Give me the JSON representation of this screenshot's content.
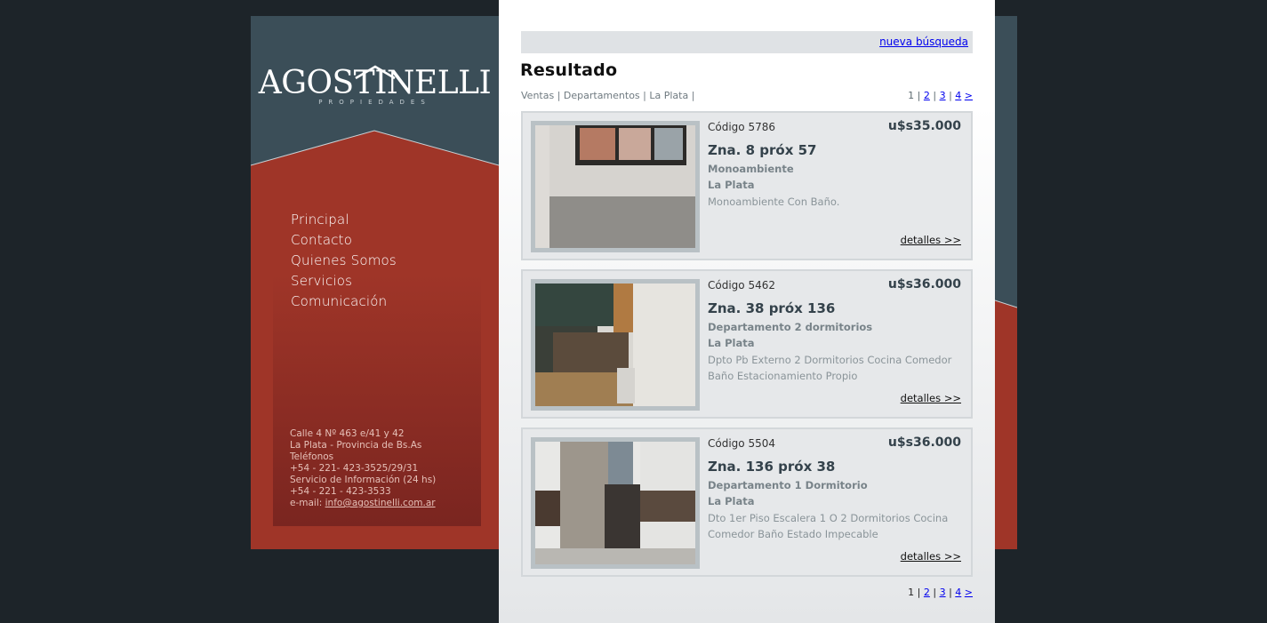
{
  "brand": {
    "name": "AGOSTINELLI",
    "subtitle": "PROPIEDADES"
  },
  "menu": [
    "Principal",
    "Contacto",
    "Quienes Somos",
    "Servicios",
    "Comunicación"
  ],
  "address": {
    "line1": "Calle 4 Nº 463 e/41 y 42",
    "line2": "La Plata - Provincia de Bs.As",
    "line3": "Teléfonos",
    "line4": "+54 - 221- 423-3525/29/31",
    "line5": "Servicio de Información (24 hs)",
    "line6": "+54 - 221 - 423-3533",
    "email_label": "e-mail: ",
    "email": "info@agostinelli.com.ar"
  },
  "search": {
    "new_search": "nueva búsqueda"
  },
  "results": {
    "title": "Resultado",
    "breadcrumb": "Ventas | Departamentos | La Plata |",
    "pager": {
      "current": "1",
      "pages": [
        "2",
        "3",
        "4"
      ],
      "next": ">"
    },
    "listings": [
      {
        "code": "Código 5786",
        "price": "u$s35.000",
        "zone": "Zna. 8 próx 57",
        "type": "Monoambiente",
        "city": "La Plata",
        "description": "Monoambiente Con Baño.",
        "details": "detalles >>"
      },
      {
        "code": "Código 5462",
        "price": "u$s36.000",
        "zone": "Zna. 38 próx 136",
        "type": "Departamento 2 dormitorios",
        "city": "La Plata",
        "description": "Dpto Pb Externo 2 Dormitorios Cocina Comedor Baño Estacionamiento Propio",
        "details": "detalles >>"
      },
      {
        "code": "Código 5504",
        "price": "u$s36.000",
        "zone": "Zna. 136 próx 38",
        "type": "Departamento 1 Dormitorio",
        "city": "La Plata",
        "description": "Dto 1er Piso Escalera 1 O 2 Dormitorios Cocina Comedor Baño Estado Impecable",
        "details": "detalles >>"
      }
    ]
  },
  "colors": {
    "background": "#1d2429",
    "slate": "#384d58",
    "brick": "#9f3528",
    "price_text": "#34424b"
  }
}
